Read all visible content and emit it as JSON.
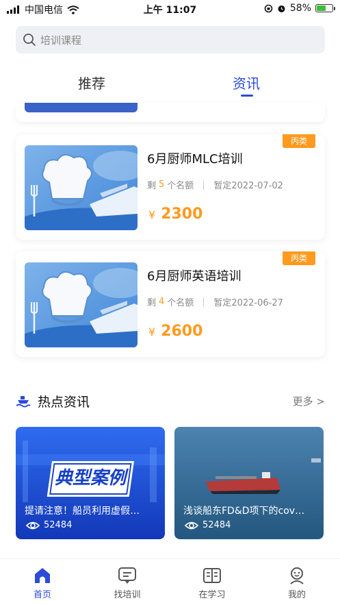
{
  "status_bar": {
    "carrier": "中国电信",
    "time": "上午 11:07",
    "battery": "58%",
    "battery_level": 0.58
  },
  "search": {
    "placeholder": "培训课程"
  },
  "tabs": [
    {
      "label": "推荐",
      "active": false
    },
    {
      "label": "资讯",
      "active": true
    }
  ],
  "courses": [
    {
      "title": "6月厨师MLC培训",
      "badge": "丙类",
      "remaining_prefix": "剩",
      "remaining": "5",
      "remaining_suffix": "个名额",
      "date": "暂定2022-07-02",
      "currency": "¥",
      "price": "2300"
    },
    {
      "title": "6月厨师英语培训",
      "badge": "丙类",
      "remaining_prefix": "剩",
      "remaining": "4",
      "remaining_suffix": "个名额",
      "date": "暂定2022-06-27",
      "currency": "¥",
      "price": "2600"
    }
  ],
  "hot_news": {
    "title": "热点资讯",
    "more": "更多 >",
    "items": [
      {
        "banner_text": "典型案例",
        "title": "提请注意！船员利用虚假…",
        "views": "52484"
      },
      {
        "title": "浅谈船东FD&D项下的cov…",
        "views": "52484"
      }
    ]
  },
  "bottom_nav": [
    {
      "label": "首页",
      "icon": "home-icon",
      "active": true
    },
    {
      "label": "找培训",
      "icon": "chat-icon",
      "active": false
    },
    {
      "label": "在学习",
      "icon": "book-icon",
      "active": false
    },
    {
      "label": "我的",
      "icon": "user-icon",
      "active": false
    }
  ],
  "colors": {
    "accent": "#2c4bd8",
    "price": "#ff9a1f",
    "badge": "#ff9a1f"
  }
}
